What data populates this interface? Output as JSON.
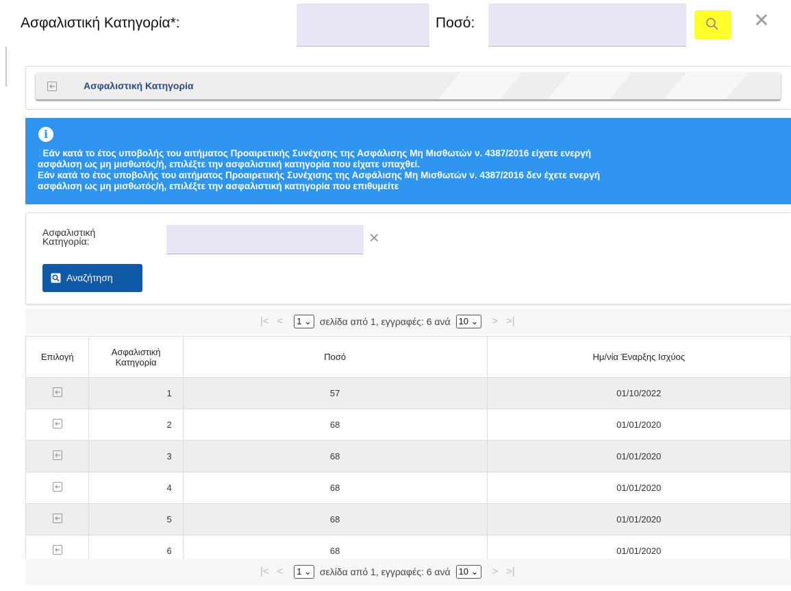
{
  "header": {
    "category_label": "Ασφαλιστική Κατηγορία*:",
    "amount_label": "Ποσό:",
    "category_value": "",
    "amount_value": "",
    "search_icon": "search-icon",
    "close_icon": "close-icon",
    "close_symbol": "✕"
  },
  "panel": {
    "title": "Ασφαλιστική Κατηγορία"
  },
  "info": {
    "icon": "i",
    "lines": [
      "  Εάν κατά το έτος υποβολής του αιτήματος Προαιρετικής Συνέχισης της Ασφάλισης Μη Μισθωτών ν. 4387/2016 είχατε ενεργή",
      "ασφάλιση ως μη μισθωτός/ή, επιλέξτε την ασφαλιστική κατηγορία που είχατε υπαχθεί.",
      "Εάν κατά το έτος υποβολής του αιτήματος Προαιρετικής Συνέχισης της Ασφάλισης Μη Μισθωτών ν. 4387/2016 δεν έχετε ενεργή",
      "ασφάλιση ως μη μισθωτός/ή, επιλέξτε την ασφαλιστική κατηγορία που επιθυμείτε"
    ]
  },
  "form": {
    "label_line1": "Ασφαλιστική",
    "label_line2": "Κατηγορία:",
    "value": "",
    "clear_symbol": "✕",
    "search_button": "Αναζήτηση"
  },
  "pager": {
    "first": "|<",
    "prev": "<",
    "page": "1",
    "text": "σελίδα από 1, εγγραφές: 6 ανά",
    "page_size": "10",
    "next": ">",
    "last": ">|"
  },
  "table": {
    "headers": {
      "select": "Επιλογή",
      "category_line1": "Ασφαλιστική",
      "category_line2": "Κατηγορία",
      "amount": "Ποσό",
      "start_date": "Ημ/νία Έναρξης Ισχύος"
    },
    "rows": [
      {
        "category": "1",
        "amount": "57",
        "date": "01/10/2022"
      },
      {
        "category": "2",
        "amount": "68",
        "date": "01/01/2020"
      },
      {
        "category": "3",
        "amount": "68",
        "date": "01/01/2020"
      },
      {
        "category": "4",
        "amount": "68",
        "date": "01/01/2020"
      },
      {
        "category": "5",
        "amount": "68",
        "date": "01/01/2020"
      },
      {
        "category": "6",
        "amount": "68",
        "date": "01/01/2020"
      }
    ]
  },
  "colors": {
    "highlight": "#ffff2a",
    "info_bg": "#2e96f0",
    "button_bg": "#0f5aa6",
    "input_bg": "#e6e6f6"
  }
}
